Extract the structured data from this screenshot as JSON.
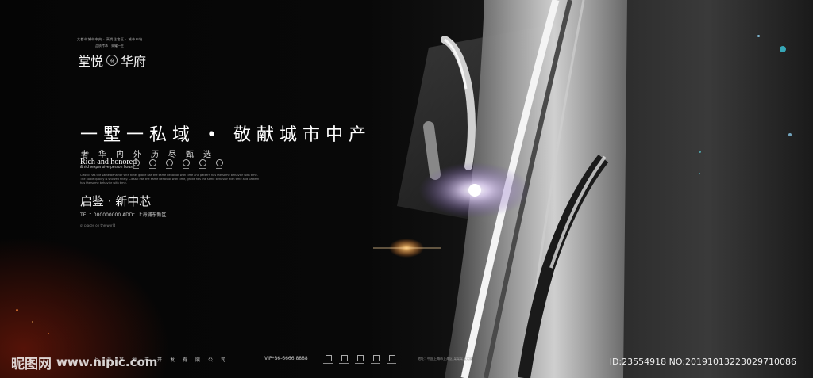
{
  "header": {
    "tagline": "大都市城市中央 · 高尚住宅区 · 城市中轴",
    "tagline2": "品质传承　荣耀一生",
    "brand_left": "堂悦",
    "brand_seal": "府",
    "brand_right": "华府"
  },
  "hero": {
    "headline": "一墅一私域 • 敬献城市中产",
    "subhead": "奢华内外历尽甄选",
    "en_title": "Rich and honored",
    "en_sub": "& rich expensive person house",
    "body_copy": "Classic has the same behavior with time, grade has the same behavior with time and pattern has the same behavior with time. The noble quality is showed finely. Classic has the same behavior with time, grade has the same behavior with time and pattern has the same behavior with time.",
    "launch": "启鉴 · 新中芯",
    "contact": "TEL：000000000  ADD：上海浦东新区",
    "tiny_note": "of places on the world"
  },
  "footer": {
    "brand": "上海某地产开发有限公司",
    "vip": "VIP*86-6666 8888",
    "addr": "地址：中国上海市上海区 某某某某大厦"
  },
  "watermark": {
    "site": "昵图网",
    "url": "www.nipic.com",
    "id": "ID:23554918 NO:20191013223029710086"
  },
  "colors": {
    "background": "#000000",
    "red_glow": "#961e0a",
    "flare": "#e8d8ff"
  }
}
